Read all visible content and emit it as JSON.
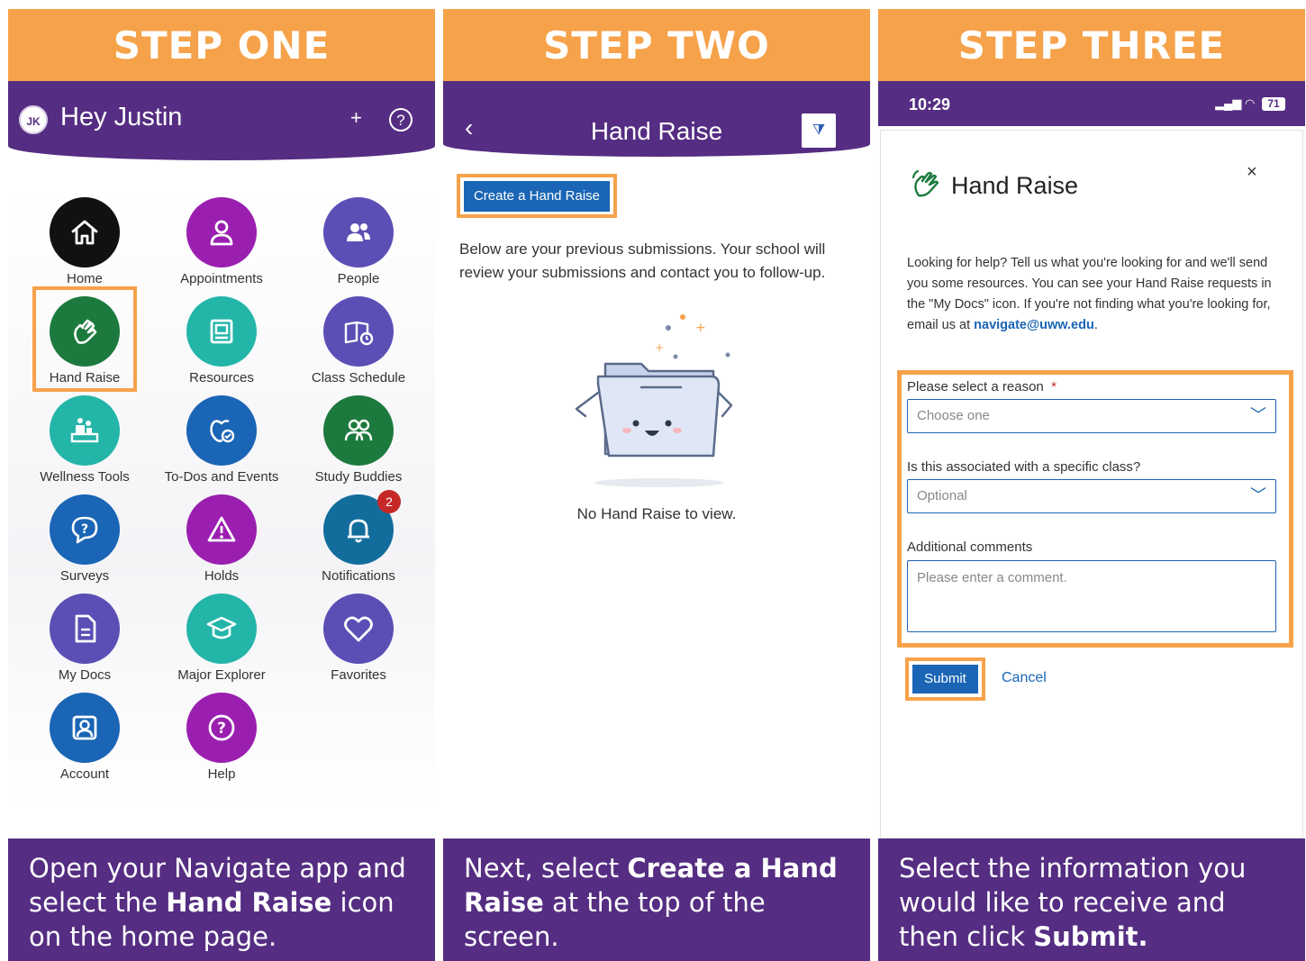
{
  "steps": [
    {
      "header": "STEP ONE"
    },
    {
      "header": "STEP TWO"
    },
    {
      "header": "STEP THREE"
    }
  ],
  "step1": {
    "avatar_initials": "JK",
    "greeting": "Hey Justin",
    "plus_symbol": "+",
    "help_symbol": "?",
    "tiles": [
      {
        "label": "Home",
        "icon": "home-icon",
        "color": "#111111"
      },
      {
        "label": "Appointments",
        "icon": "person-icon",
        "color": "#9a1fb0"
      },
      {
        "label": "People",
        "icon": "people-icon",
        "color": "#5b4fb6"
      },
      {
        "label": "Hand Raise",
        "icon": "hand-raise-icon",
        "color": "#1d7a3e"
      },
      {
        "label": "Resources",
        "icon": "resources-icon",
        "color": "#24b5a9"
      },
      {
        "label": "Class Schedule",
        "icon": "class-schedule-icon",
        "color": "#5b4fb6"
      },
      {
        "label": "Wellness Tools",
        "icon": "wellness-icon",
        "color": "#24b5a9"
      },
      {
        "label": "To-Dos and Events",
        "icon": "todo-icon",
        "color": "#1a65b5"
      },
      {
        "label": "Study Buddies",
        "icon": "study-buddies-icon",
        "color": "#1d7a3e"
      },
      {
        "label": "Surveys",
        "icon": "surveys-icon",
        "color": "#1a65b5"
      },
      {
        "label": "Holds",
        "icon": "holds-icon",
        "color": "#9a1fb0"
      },
      {
        "label": "Notifications",
        "icon": "bell-icon",
        "color": "#136d9c",
        "badge": "2"
      },
      {
        "label": "My Docs",
        "icon": "document-icon",
        "color": "#5b4fb6"
      },
      {
        "label": "Major Explorer",
        "icon": "graduation-cap-icon",
        "color": "#24b5a9"
      },
      {
        "label": "Favorites",
        "icon": "heart-icon",
        "color": "#5b4fb6"
      },
      {
        "label": "Account",
        "icon": "account-icon",
        "color": "#1a65b5"
      },
      {
        "label": "Help",
        "icon": "help-icon",
        "color": "#9a1fb0"
      }
    ],
    "caption_a": "Open your Navigate app and select the ",
    "caption_bold": "Hand Raise",
    "caption_b": " icon on the home page."
  },
  "step2": {
    "back_symbol": "‹",
    "title": "Hand Raise",
    "filter_symbol": "⧩",
    "create_button": "Create a Hand Raise",
    "description": "Below are your previous submissions. Your school will review your submissions and contact you to follow-up.",
    "empty_message": "No Hand Raise to view.",
    "caption_a": "Next, select ",
    "caption_bold": "Create a Hand Raise",
    "caption_b": " at the top of the screen."
  },
  "step3": {
    "time": "10:29",
    "battery": "71",
    "title": "Hand Raise",
    "close_symbol": "×",
    "description_a": "Looking for help? Tell us what you're looking for and we'll send you some resources. You can see your Hand Raise requests in the \"My Docs\" icon. If you're not finding what you're looking for, email us at ",
    "email": "navigate@uww.edu",
    "description_b": ".",
    "reason_label": "Please select a reason",
    "required_mark": "*",
    "reason_placeholder": "Choose one",
    "class_label": "Is this associated with a specific class?",
    "class_placeholder": "Optional",
    "comments_label": "Additional comments",
    "comments_placeholder": "Please enter a comment.",
    "submit": "Submit",
    "cancel": "Cancel",
    "caption_a": "Select the information you would like to receive and then click ",
    "caption_bold": "Submit."
  }
}
